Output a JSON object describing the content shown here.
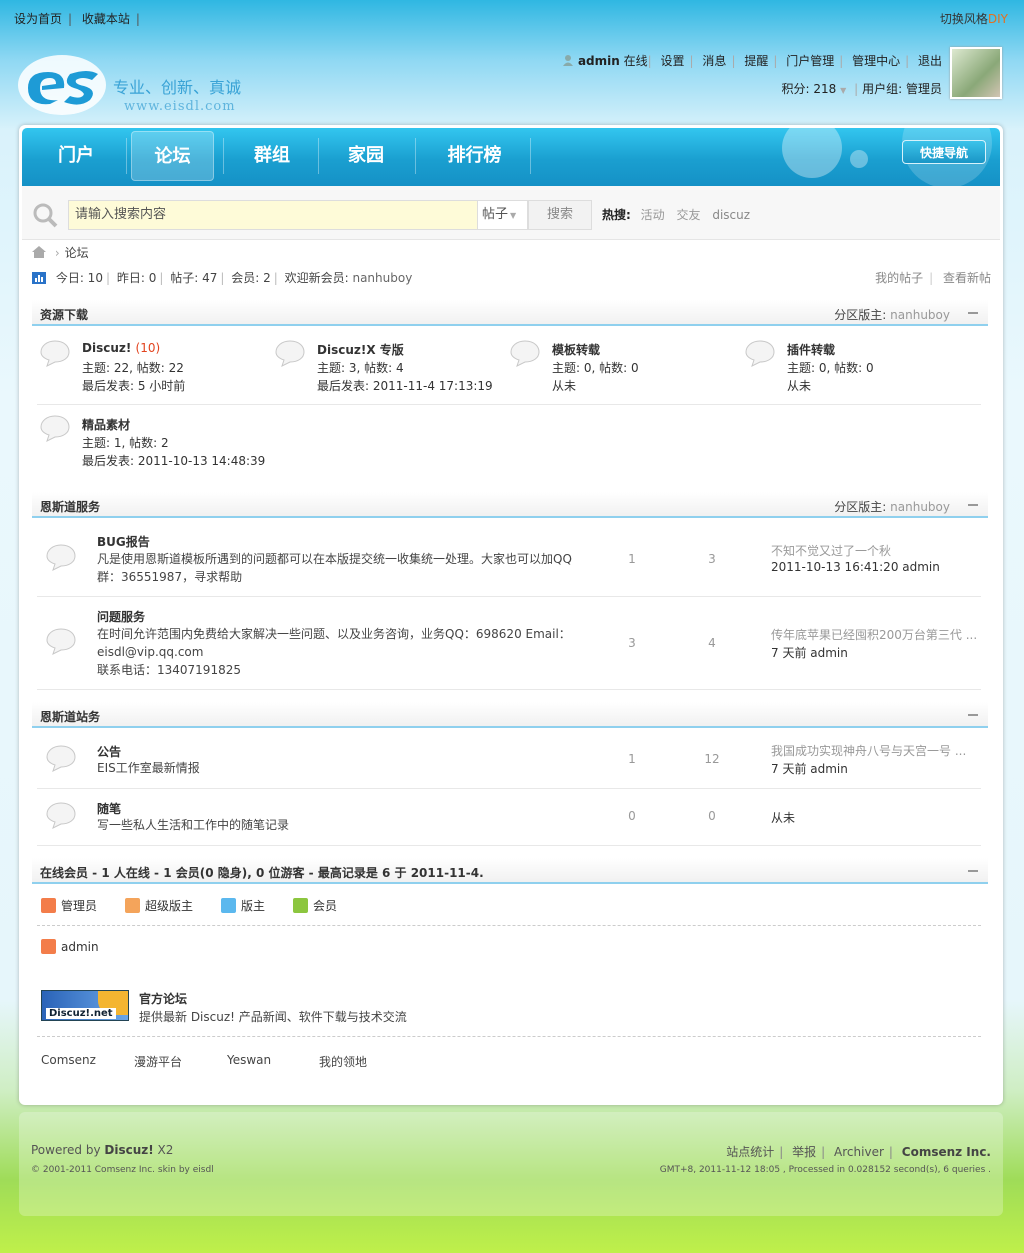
{
  "topbar": {
    "set_home": "设为首页",
    "bookmark": "收藏本站",
    "switch_style": "切换风格",
    "diy": "DIY"
  },
  "brand": {
    "slogan": "专业、创新、真诚",
    "url": "www.eisdl.com"
  },
  "user": {
    "name": "admin",
    "status": "在线",
    "links": [
      "设置",
      "消息",
      "提醒",
      "门户管理",
      "管理中心",
      "退出"
    ],
    "points_label": "积分: 218",
    "group": "用户组: 管理员"
  },
  "nav": {
    "items": [
      "门户",
      "论坛",
      "群组",
      "家园",
      "排行榜"
    ],
    "active": "论坛",
    "quick": "快捷导航"
  },
  "search": {
    "placeholder": "请输入搜索内容",
    "type": "帖子",
    "button": "搜索",
    "hot_label": "热搜:",
    "hot": [
      "活动",
      "交友",
      "discuz"
    ]
  },
  "breadcrumb": {
    "current": "论坛"
  },
  "stats": {
    "today": "今日: 10",
    "yesterday": "昨日: 0",
    "posts": "帖子: 47",
    "members": "会员: 2",
    "welcome": "欢迎新会员: ",
    "newest": "nanhuboy",
    "my_posts": "我的帖子",
    "new_posts": "查看新帖"
  },
  "sections": [
    {
      "title": "资源下载",
      "mod_label": "分区版主:",
      "mod": "nanhuboy",
      "forums": [
        {
          "name": "Discuz!",
          "today": "(10)",
          "stats": "主题: 22, 帖数: 22",
          "last": "最后发表: 5 小时前"
        },
        {
          "name": "Discuz!X 专版",
          "stats": "主题: 3, 帖数: 4",
          "last": "最后发表: 2011-11-4 17:13:19"
        },
        {
          "name": "模板转载",
          "stats": "主题: 0, 帖数: 0",
          "last": "从未"
        },
        {
          "name": "插件转载",
          "stats": "主题: 0, 帖数: 0",
          "last": "从未"
        },
        {
          "name": "精品素材",
          "stats": "主题: 1, 帖数: 2",
          "last": "最后发表: 2011-10-13 14:48:39"
        }
      ]
    },
    {
      "title": "恩斯道服务",
      "mod_label": "分区版主:",
      "mod": "nanhuboy",
      "forums": [
        {
          "name": "BUG报告",
          "desc1": "凡是使用恩斯道模板所遇到的问题都可以在本版提交统一收集统一处理。大家也可以加QQ",
          "desc2": "群：36551987，寻求帮助",
          "threads": "1",
          "posts": "3",
          "last_title": "不知不觉又过了一个秋",
          "last_info": "2011-10-13 16:41:20 admin"
        },
        {
          "name": "问题服务",
          "desc1": "在时间允许范围内免费给大家解决一些问题、以及业务咨询，业务QQ：698620 Email：",
          "desc2": "eisdl@vip.qq.com",
          "desc3": "联系电话：13407191825",
          "threads": "3",
          "posts": "4",
          "last_title": "传年底苹果已经囤积200万台第三代 ...",
          "last_info": "7 天前 admin"
        }
      ]
    },
    {
      "title": "恩斯道站务",
      "forums": [
        {
          "name": "公告",
          "desc1": "EIS工作室最新情报",
          "threads": "1",
          "posts": "12",
          "last_title": "我国成功实现神舟八号与天宫一号 ...",
          "last_info": "7 天前 admin"
        },
        {
          "name": "随笔",
          "desc1": "写一些私人生活和工作中的随笔记录",
          "threads": "0",
          "posts": "0",
          "last_info": "从未"
        }
      ]
    }
  ],
  "online": {
    "title": "在线会员 - 1 人在线 - 1 会员(0 隐身), 0 位游客 - 最高记录是 6 于 2011-11-4.",
    "legend": [
      "管理员",
      "超级版主",
      "版主",
      "会员"
    ],
    "user": "admin"
  },
  "partner": {
    "logo_text": "Discuz!.net",
    "name": "官方论坛",
    "desc": "提供最新 Discuz! 产品新闻、软件下载与技术交流"
  },
  "friend_links": [
    "Comsenz",
    "漫游平台",
    "Yeswan",
    "我的领地"
  ],
  "footer": {
    "powered": "Powered by ",
    "product": "Discuz!",
    "version": " X2",
    "copyright": "© 2001-2011 Comsenz Inc. skin by eisdl",
    "links": [
      "站点统计",
      "举报",
      "Archiver"
    ],
    "company": "Comsenz Inc.",
    "debug": "GMT+8, 2011-11-12 18:05 , Processed in 0.028152 second(s), 6 queries ."
  },
  "colors": {
    "nav": "#1a9fd0",
    "accent": "#8fd0ee",
    "admin": "#f37d4a",
    "supermod": "#f4a45b",
    "mod": "#5bb8ee",
    "member": "#8cc63f"
  }
}
